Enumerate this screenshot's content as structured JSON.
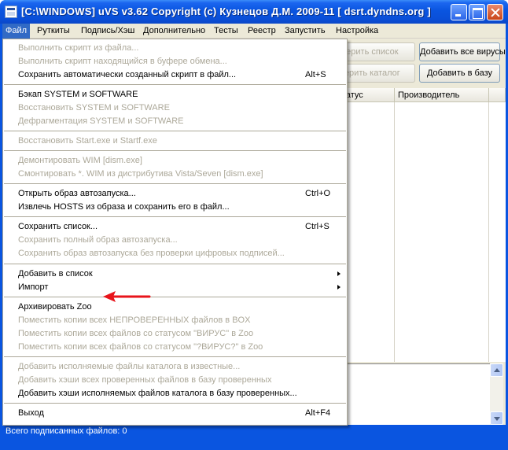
{
  "window": {
    "title": "[C:\\WINDOWS] uVS v3.62 Copyright (c) Кузнецов Д.М. 2009-11 [ dsrt.dyndns.org ]"
  },
  "menubar": [
    "Файл",
    "Руткиты",
    "Подпись/Хэш",
    "Дополнительно",
    "Тесты",
    "Реестр",
    "Запустить",
    "Настройка"
  ],
  "buttons": {
    "check_list": "верить список",
    "check_catalog": "верить каталог",
    "add_all_viruses": "Добавить все вирусы",
    "add_to_db": "Добавить в базу"
  },
  "columns": {
    "status": "Статус",
    "manufacturer": "Производитель"
  },
  "status_bar": {
    "text": "Всего подписанных файлов: 0"
  },
  "file_menu": {
    "items": [
      {
        "label": "Выполнить скрипт из файла...",
        "shortcut": "",
        "enabled": false,
        "submenu": false
      },
      {
        "label": "Выполнить скрипт находящийся в буфере обмена...",
        "shortcut": "",
        "enabled": false,
        "submenu": false
      },
      {
        "label": "Сохранить автоматически созданный скрипт в файл...",
        "shortcut": "Alt+S",
        "enabled": true,
        "submenu": false
      },
      {
        "label": "Бэкап SYSTEM и SOFTWARE",
        "shortcut": "",
        "enabled": true,
        "submenu": false
      },
      {
        "label": "Восстановить SYSTEM и SOFTWARE",
        "shortcut": "",
        "enabled": false,
        "submenu": false
      },
      {
        "label": "Дефрагментация SYSTEM и SOFTWARE",
        "shortcut": "",
        "enabled": false,
        "submenu": false
      },
      {
        "label": "Восстановить Start.exe и Startf.exe",
        "shortcut": "",
        "enabled": false,
        "submenu": false
      },
      {
        "label": "Демонтировать  WIM [dism.exe]",
        "shortcut": "",
        "enabled": false,
        "submenu": false
      },
      {
        "label": "Смонтировать *. WIM из дистрибутива Vista/Seven [dism.exe]",
        "shortcut": "",
        "enabled": false,
        "submenu": false
      },
      {
        "label": "Открыть образ автозапуска...",
        "shortcut": "Ctrl+O",
        "enabled": true,
        "submenu": false
      },
      {
        "label": "Извлечь HOSTS из образа и сохранить его в файл...",
        "shortcut": "",
        "enabled": true,
        "submenu": false
      },
      {
        "label": "Сохранить список...",
        "shortcut": "Ctrl+S",
        "enabled": true,
        "submenu": false
      },
      {
        "label": "Сохранить полный образ автозапуска...",
        "shortcut": "",
        "enabled": false,
        "submenu": false
      },
      {
        "label": "Сохранить образ автозапуска без проверки цифровых подписей...",
        "shortcut": "",
        "enabled": false,
        "submenu": false
      },
      {
        "label": "Добавить в список",
        "shortcut": "",
        "enabled": true,
        "submenu": true
      },
      {
        "label": "Импорт",
        "shortcut": "",
        "enabled": true,
        "submenu": true
      },
      {
        "label": "Архивировать Zoo",
        "shortcut": "",
        "enabled": true,
        "submenu": false
      },
      {
        "label": "Поместить копии всех НЕПРОВЕРЕННЫХ файлов в BOX",
        "shortcut": "",
        "enabled": false,
        "submenu": false
      },
      {
        "label": "Поместить копии всех файлов со статусом \"ВИРУС\" в Zoo",
        "shortcut": "",
        "enabled": false,
        "submenu": false
      },
      {
        "label": "Поместить копии всех файлов со статусом \"?ВИРУС?\" в Zoo",
        "shortcut": "",
        "enabled": false,
        "submenu": false
      },
      {
        "label": "Добавить исполняемые файлы каталога в известные...",
        "shortcut": "",
        "enabled": false,
        "submenu": false
      },
      {
        "label": "Добавить хэши всех проверенных файлов в базу проверенных",
        "shortcut": "",
        "enabled": false,
        "submenu": false
      },
      {
        "label": "Добавить хэши исполняемых файлов каталога в базу проверенных...",
        "shortcut": "",
        "enabled": true,
        "submenu": false
      },
      {
        "label": "Выход",
        "shortcut": "Alt+F4",
        "enabled": true,
        "submenu": false
      }
    ]
  },
  "colors": {
    "titlebar": "#0a55e0",
    "menu_highlight": "#316ac5",
    "disabled_text": "#aca899",
    "annotation_arrow": "#e8141b"
  }
}
